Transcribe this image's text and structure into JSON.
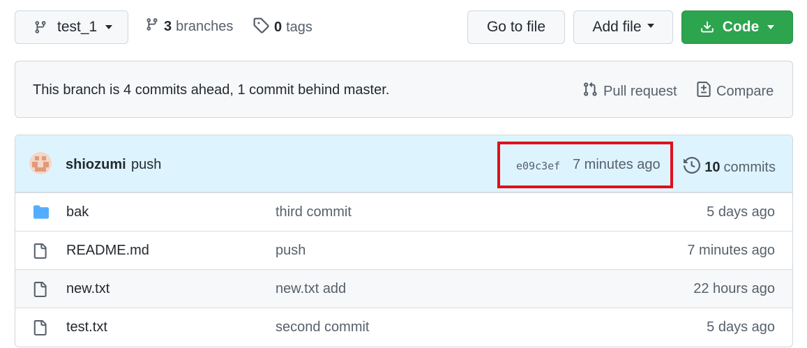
{
  "header": {
    "branch_button": {
      "label": "test_1",
      "icon": "git-branch-icon"
    },
    "branches": {
      "count": "3",
      "label": "branches",
      "icon": "git-branch-icon"
    },
    "tags": {
      "count": "0",
      "label": "tags",
      "icon": "tag-icon"
    },
    "goto_file_label": "Go to file",
    "add_file_label": "Add file",
    "code_label": "Code"
  },
  "notice": {
    "text": "This branch is 4 commits ahead, 1 commit behind master.",
    "pull_request_label": "Pull request",
    "compare_label": "Compare"
  },
  "latest_commit": {
    "author": "shiozumi",
    "message": "push",
    "sha": "e09c3ef",
    "time": "7 minutes ago",
    "commit_count": "10",
    "commit_label": "commits"
  },
  "files": [
    {
      "type": "folder",
      "name": "bak",
      "message": "third commit",
      "time": "5 days ago"
    },
    {
      "type": "file",
      "name": "README.md",
      "message": "push",
      "time": "7 minutes ago"
    },
    {
      "type": "file",
      "name": "new.txt",
      "message": "new.txt add",
      "time": "22 hours ago"
    },
    {
      "type": "file",
      "name": "test.txt",
      "message": "second commit",
      "time": "5 days ago"
    }
  ],
  "colors": {
    "code_button": "#2da44e",
    "commit_bar": "#ddf4ff",
    "folder_icon": "#54aeff",
    "highlight": "#e0101e"
  }
}
